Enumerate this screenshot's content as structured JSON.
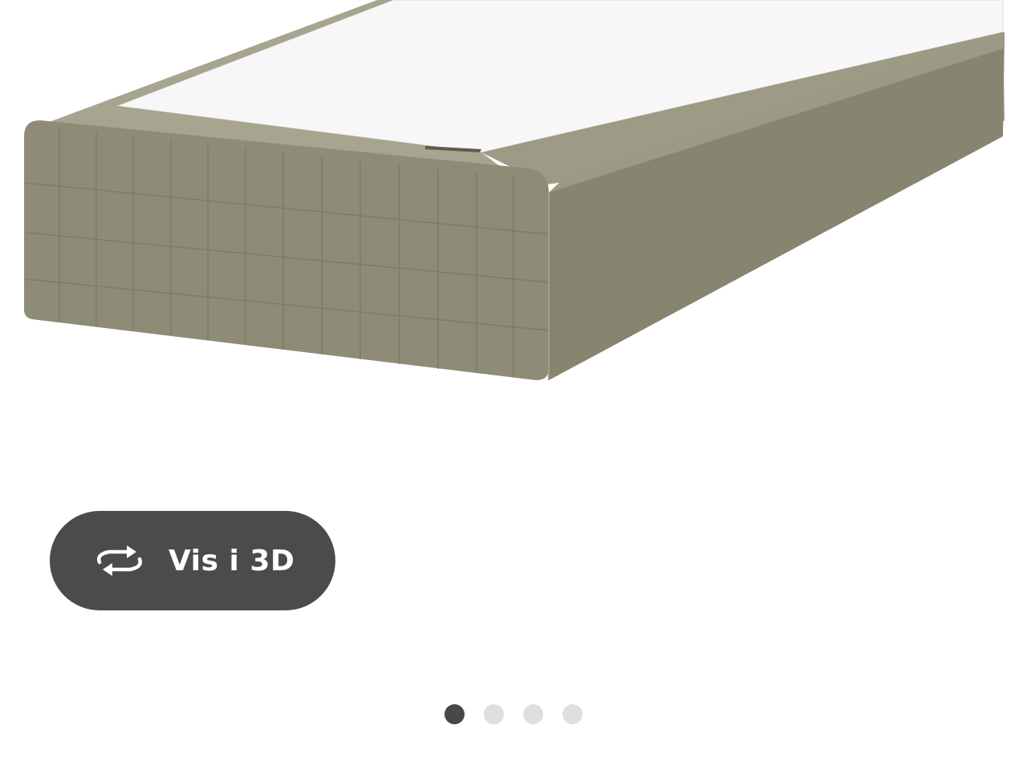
{
  "product_image": {
    "alt": "",
    "fabric_color": "#8e8b77",
    "mattress_color": "#f6f6f6"
  },
  "view_3d_button": {
    "label": "Vis i 3D",
    "icon": "rotate-3d-icon"
  },
  "carousel": {
    "dot_count": 4,
    "active_index": 0
  },
  "colors": {
    "button_bg": "#4b4b4b",
    "dot_active": "#484848",
    "dot_inactive": "#dfdfdf"
  }
}
